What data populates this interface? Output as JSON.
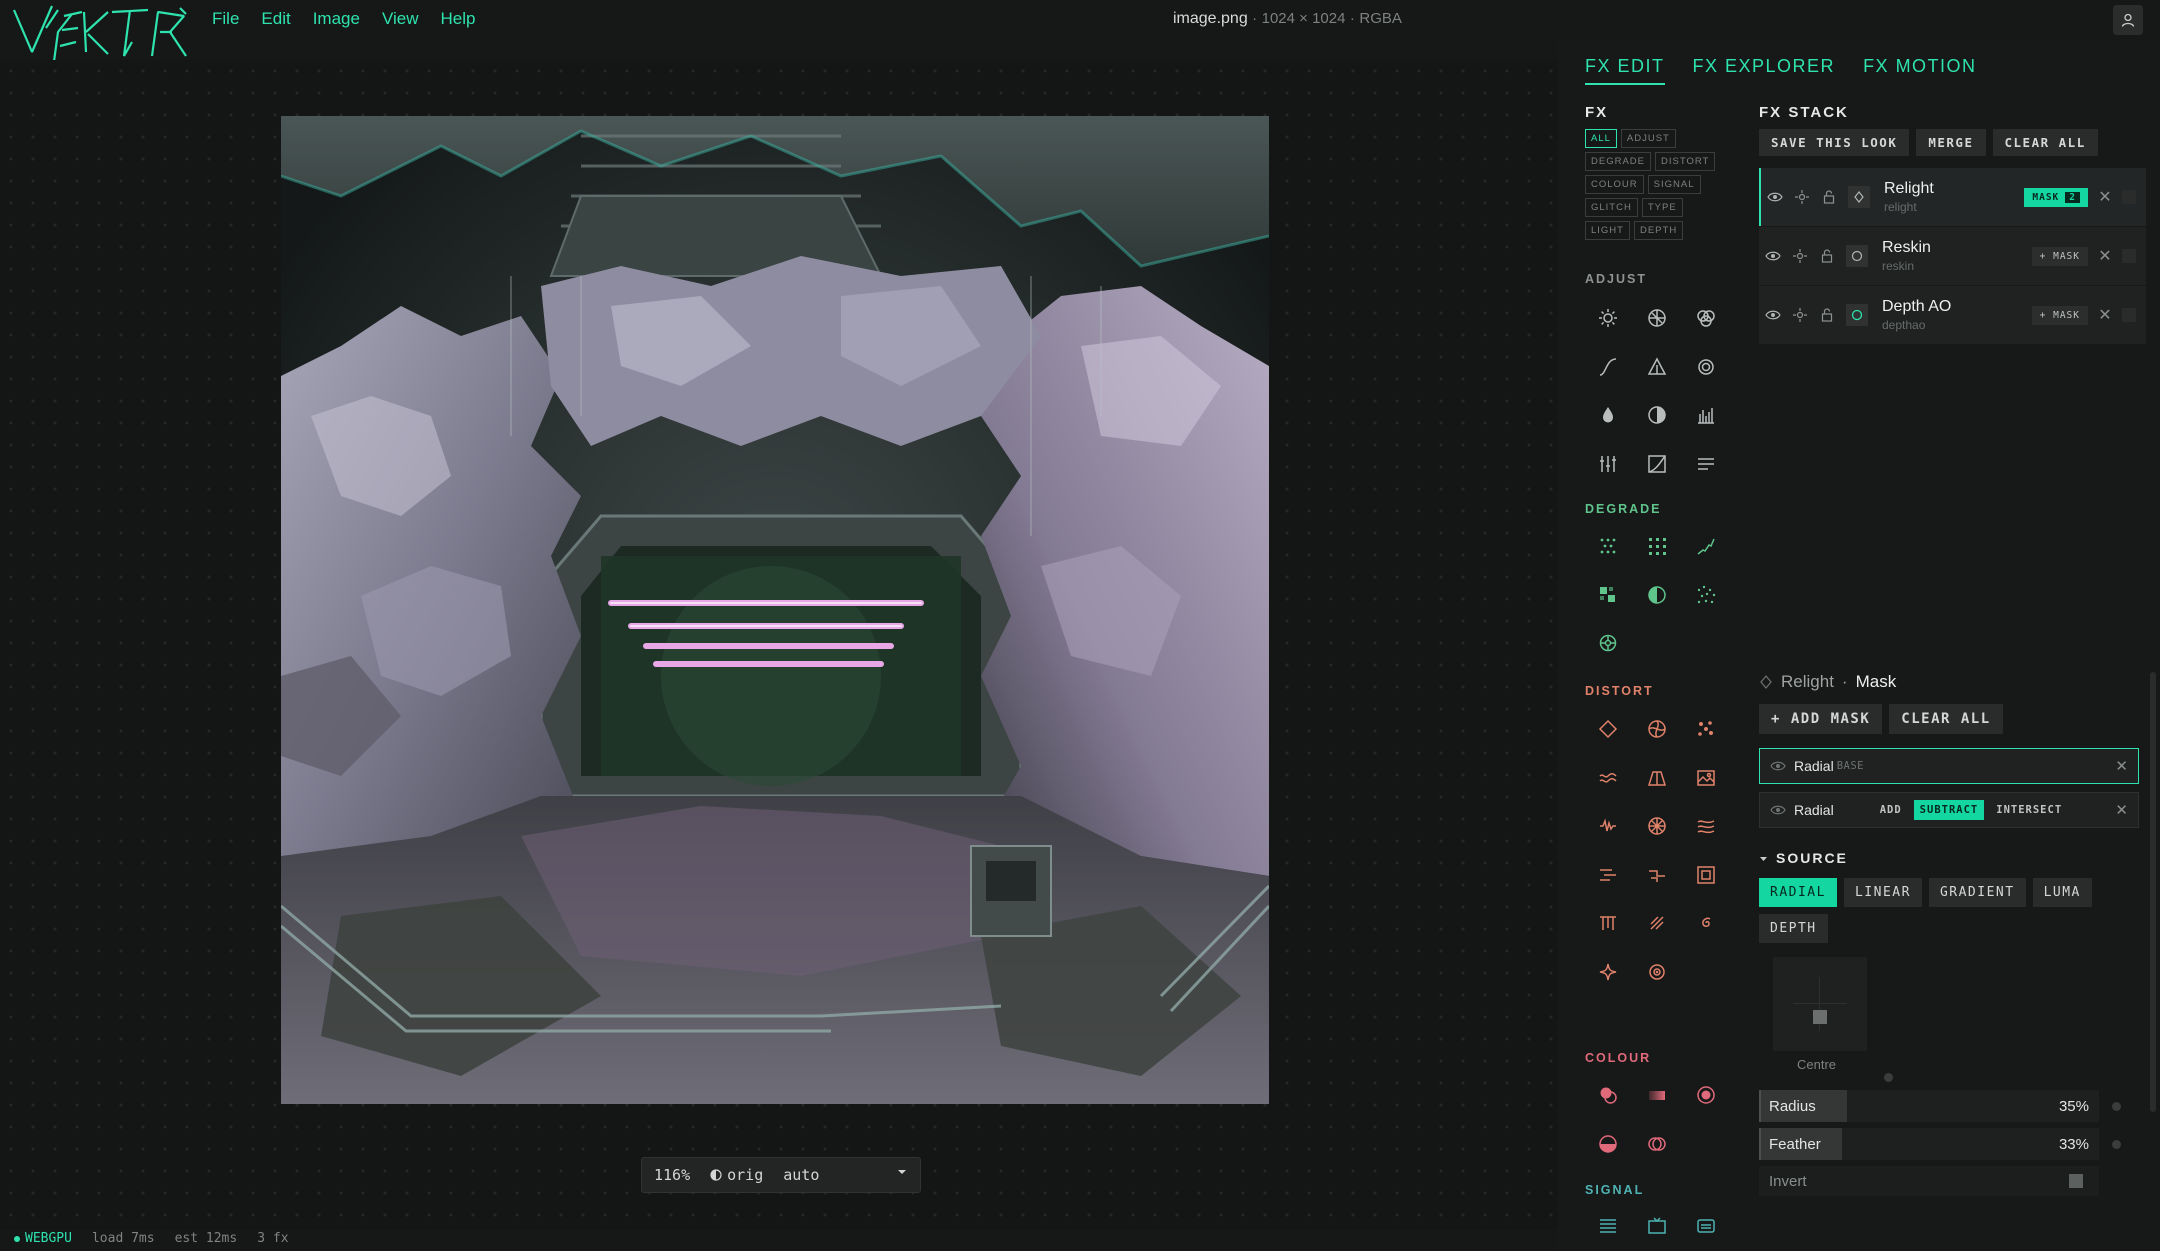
{
  "app": {
    "logo_text": "VEKTR",
    "menu": [
      "File",
      "Edit",
      "Image",
      "View",
      "Help"
    ],
    "doc": {
      "filename": "image.png",
      "sep": "·",
      "dimensions": "1024 × 1024",
      "mode": "RGBA"
    }
  },
  "fx_tabs": [
    {
      "label": "FX EDIT",
      "active": true
    },
    {
      "label": "FX EXPLORER",
      "active": false
    },
    {
      "label": "FX MOTION",
      "active": false
    }
  ],
  "fx_library": {
    "title": "FX",
    "filters": [
      {
        "label": "ALL",
        "active": true
      },
      {
        "label": "ADJUST"
      },
      {
        "label": "DEGRADE"
      },
      {
        "label": "DISTORT"
      },
      {
        "label": "COLOUR"
      },
      {
        "label": "SIGNAL"
      },
      {
        "label": "GLITCH"
      },
      {
        "label": "TYPE"
      },
      {
        "label": "LIGHT"
      },
      {
        "label": "DEPTH"
      }
    ],
    "groups": {
      "adjust": "ADJUST",
      "degrade": "DEGRADE",
      "distort": "DISTORT",
      "colour": "COLOUR",
      "signal": "SIGNAL"
    },
    "colors": {
      "adjust": "#b9bebd",
      "degrade": "#5fc58c",
      "distort": "#e0826a",
      "colour": "#e06a7a",
      "signal": "#4fb3b3"
    }
  },
  "fx_stack": {
    "title": "FX STACK",
    "buttons": {
      "save": "SAVE THIS LOOK",
      "merge": "MERGE",
      "clear": "CLEAR ALL"
    },
    "layers": [
      {
        "name": "Relight",
        "id": "relight",
        "mask_label": "MASK",
        "mask_count": "2",
        "selected": true
      },
      {
        "name": "Reskin",
        "id": "reskin",
        "mask_label": "+ MASK"
      },
      {
        "name": "Depth AO",
        "id": "depthao",
        "mask_label": "+ MASK"
      }
    ]
  },
  "mask_editor": {
    "layer": "Relight",
    "sep": "·",
    "title": "Mask",
    "buttons": {
      "add": "+ ADD MASK",
      "clear": "CLEAR ALL"
    },
    "masks": [
      {
        "name": "Radial",
        "tag": "BASE"
      },
      {
        "name": "Radial",
        "ops": [
          "ADD",
          "SUBTRACT",
          "INTERSECT"
        ],
        "active_op": "SUBTRACT"
      }
    ],
    "source": {
      "title": "SOURCE",
      "options": [
        "RADIAL",
        "LINEAR",
        "GRADIENT",
        "LUMA",
        "DEPTH"
      ],
      "active": "RADIAL"
    },
    "centre_label": "Centre",
    "radius": {
      "label": "Radius",
      "value": "35%",
      "fraction": 0.35
    },
    "feather": {
      "label": "Feather",
      "value": "33%",
      "fraction": 0.33
    },
    "invert": {
      "label": "Invert"
    }
  },
  "zoombar": {
    "zoom": "116%",
    "orig": "orig",
    "mode": "auto"
  },
  "status": {
    "backend": "WEBGPU",
    "load": "load 7ms",
    "est": "est 12ms",
    "fx": "3 fx"
  },
  "colors": {
    "accent": "#2ee3ad",
    "accent_fill": "#13d6a0",
    "bg": "#161717"
  }
}
